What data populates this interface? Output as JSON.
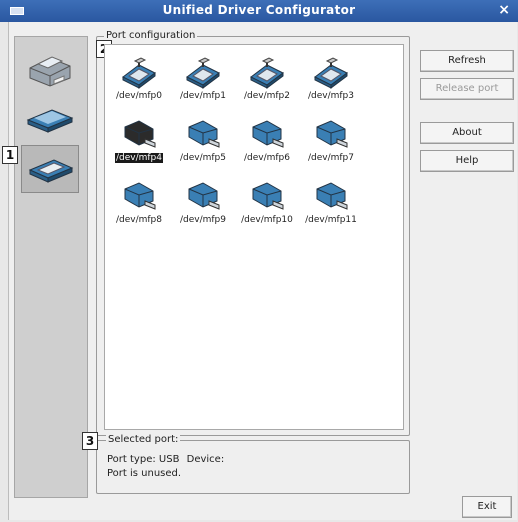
{
  "window": {
    "title": "Unified Driver Configurator",
    "close_glyph": "×"
  },
  "sidebar": {
    "items": [
      {
        "name": "printer",
        "icon": "printer-icon"
      },
      {
        "name": "scanner",
        "icon": "scanner-icon"
      },
      {
        "name": "port",
        "icon": "port-icon",
        "selected": true
      }
    ]
  },
  "callouts": {
    "one": "1",
    "two": "2",
    "three": "3"
  },
  "port_configuration": {
    "label": "Port configuration",
    "ports": [
      {
        "label": "/dev/mfp0",
        "kind": "parallel"
      },
      {
        "label": "/dev/mfp1",
        "kind": "parallel"
      },
      {
        "label": "/dev/mfp2",
        "kind": "parallel"
      },
      {
        "label": "/dev/mfp3",
        "kind": "parallel"
      },
      {
        "label": "/dev/mfp4",
        "kind": "usb",
        "selected": true
      },
      {
        "label": "/dev/mfp5",
        "kind": "usb"
      },
      {
        "label": "/dev/mfp6",
        "kind": "usb"
      },
      {
        "label": "/dev/mfp7",
        "kind": "usb"
      },
      {
        "label": "/dev/mfp8",
        "kind": "usb"
      },
      {
        "label": "/dev/mfp9",
        "kind": "usb"
      },
      {
        "label": "/dev/mfp10",
        "kind": "usb"
      },
      {
        "label": "/dev/mfp11",
        "kind": "usb"
      }
    ]
  },
  "buttons": {
    "refresh": "Refresh",
    "release_port": "Release port",
    "about": "About",
    "help": "Help",
    "exit": "Exit"
  },
  "selected_port": {
    "label": "Selected port:",
    "port_type_label": "Port type:",
    "port_type_value": "USB",
    "device_label": "Device:",
    "device_value": "",
    "status": "Port is unused."
  },
  "colors": {
    "titlebar": "#2f5fab",
    "icon_blue": "#3a7fb4",
    "selected_icon": "#2b2b2b"
  }
}
